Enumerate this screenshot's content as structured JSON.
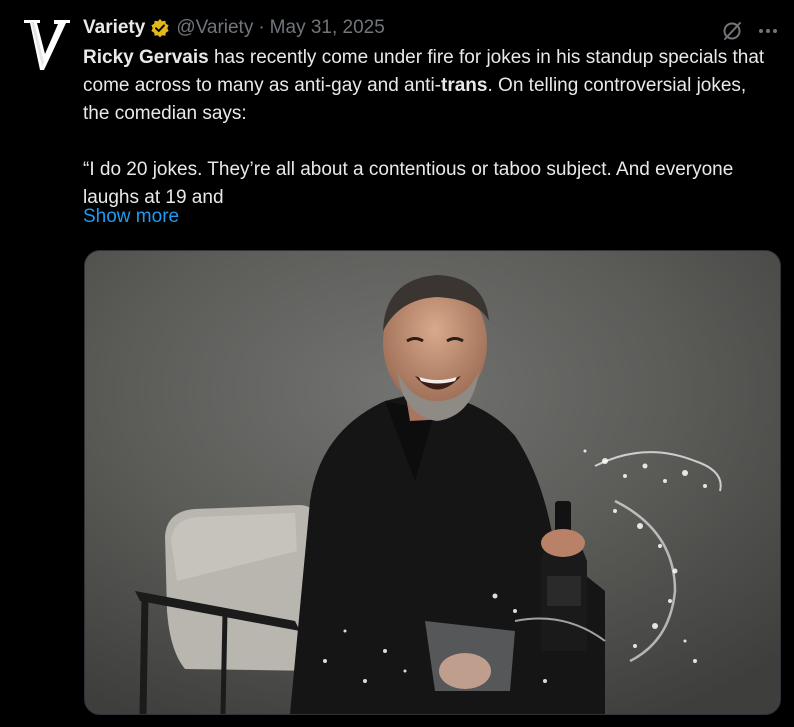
{
  "tweet": {
    "author": {
      "name": "Variety",
      "handle": "@Variety",
      "avatar_icon": "variety-v-logo",
      "verified_color": "#e2b719"
    },
    "separator": "·",
    "date": "May 31, 2025",
    "body": {
      "p1_bold_name": "Ricky Gervais",
      "p1_mid": " has recently come under fire for jokes in his standup specials that come across to many as anti-gay and anti-",
      "p1_bold_trans": "trans",
      "p1_end": ". On telling controversial jokes, the comedian says:",
      "p2": "“I do 20 jokes. They’re all about a contentious or taboo subject. And everyone laughs at 19 and"
    },
    "show_more": "Show more",
    "toolbar_icons": [
      "grok-icon",
      "more-icon"
    ],
    "media": {
      "alt": "Ricky Gervais laughing, holding a vodka bottle with water splashing"
    }
  },
  "colors": {
    "background": "#000000",
    "text": "#e7e9ea",
    "muted": "#71767b",
    "link": "#1d9bf0"
  }
}
